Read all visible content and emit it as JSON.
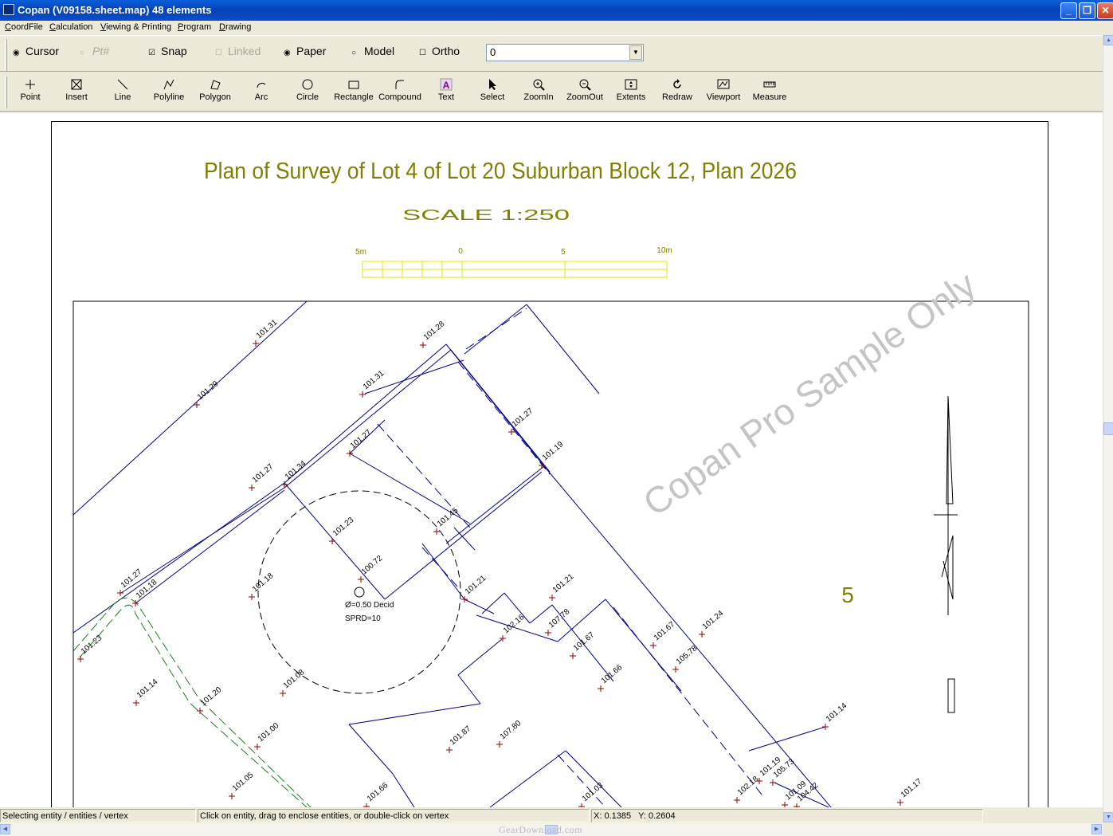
{
  "window": {
    "title": "Copan (V09158.sheet.map) 48 elements",
    "minimize": "_",
    "maximize": "❐",
    "close": "✕"
  },
  "menu": [
    "CoordFile",
    "Calculation",
    "Viewing & Printing",
    "Program",
    "Drawing"
  ],
  "options": {
    "cursor": {
      "label": "Cursor",
      "checked": true
    },
    "pt": {
      "label": "Pt#",
      "checked": false,
      "disabled": true
    },
    "snap": {
      "label": "Snap",
      "checked": true
    },
    "linked": {
      "label": "Linked",
      "checked": false,
      "disabled": true
    },
    "paper": {
      "label": "Paper",
      "checked": true
    },
    "model": {
      "label": "Model",
      "checked": false
    },
    "ortho": {
      "label": "Ortho",
      "checked": false
    },
    "layer_value": "0"
  },
  "tools": [
    {
      "label": "Point",
      "icon": "point-icon"
    },
    {
      "label": "Insert",
      "icon": "insert-icon"
    },
    {
      "label": "Line",
      "icon": "line-icon"
    },
    {
      "label": "Polyline",
      "icon": "polyline-icon"
    },
    {
      "label": "Polygon",
      "icon": "polygon-icon"
    },
    {
      "label": "Arc",
      "icon": "arc-icon"
    },
    {
      "label": "Circle",
      "icon": "circle-icon"
    },
    {
      "label": "Rectangle",
      "icon": "rectangle-icon"
    },
    {
      "label": "Compound",
      "icon": "compound-icon"
    },
    {
      "label": "Text",
      "icon": "text-icon"
    },
    {
      "label": "Select",
      "icon": "select-icon"
    },
    {
      "label": "ZoomIn",
      "icon": "zoom-in-icon"
    },
    {
      "label": "ZoomOut",
      "icon": "zoom-out-icon"
    },
    {
      "label": "Extents",
      "icon": "extents-icon"
    },
    {
      "label": "Redraw",
      "icon": "redraw-icon"
    },
    {
      "label": "Viewport",
      "icon": "viewport-icon"
    },
    {
      "label": "Measure",
      "icon": "measure-icon"
    }
  ],
  "drawing": {
    "title": "Plan of Survey of Lot 4 of Lot 20 Suburban Block 12, Plan 2026",
    "scale_text": "SCALE    1:250",
    "scale_bar_labels": [
      "5m",
      "0",
      "5",
      "10m"
    ],
    "watermark": "Copan Pro Sample Only",
    "lot_number": "5",
    "tree_label_1": "Ø=0.50 Decid",
    "tree_label_2": "SPRD=10",
    "colors": {
      "title": "#7f7f00",
      "points": "#8b0000",
      "lines": "#00008b",
      "hedge": "#1e7b1e",
      "scale_bar": "#e6e600"
    },
    "spot_heights": [
      "101.31",
      "101.29",
      "101.28",
      "101.31",
      "101.27",
      "101.27",
      "101.34",
      "101.19",
      "101.27",
      "101.23",
      "101.45",
      "100.72",
      "101.27",
      "101.18",
      "101.18",
      "101.21",
      "101.21",
      "101.23",
      "102.16",
      "107.78",
      "101.67",
      "101.67",
      "105.78",
      "101.24",
      "101.14",
      "101.20",
      "101.08",
      "101.66",
      "101.00",
      "101.87",
      "107.80",
      "101.05",
      "101.14",
      "101.19",
      "105.73",
      "102.18",
      "101.09",
      "104.42",
      "101.17",
      "101.66",
      "101.03"
    ]
  },
  "status": {
    "mode": "Selecting entity / entities / vertex",
    "hint": "Click on entity, drag to enclose entities, or double-click on vertex",
    "x_label": "X:",
    "x_value": "0.1385",
    "y_label": "Y:",
    "y_value": "0.2604"
  },
  "footer_watermark": "GearDownload.com"
}
